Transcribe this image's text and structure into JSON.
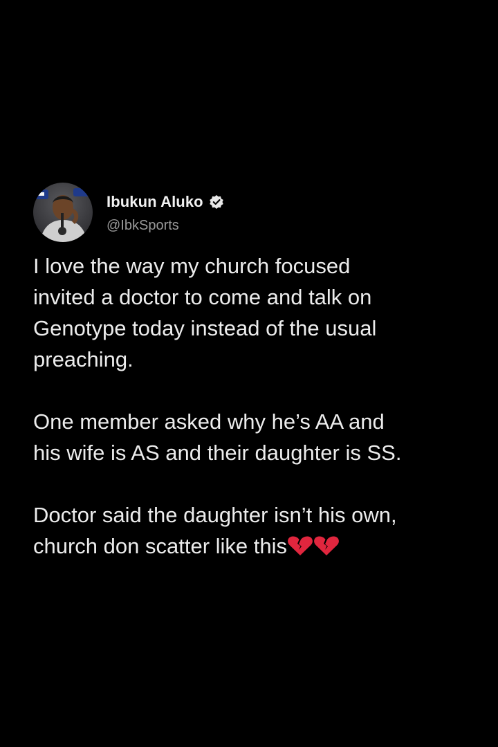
{
  "tweet": {
    "author": {
      "display_name": "Ibukun Aluko",
      "handle": "@IbkSports",
      "verified": true,
      "avatar_icon": "profile-photo"
    },
    "paragraphs": [
      [
        "I love the way my church focused",
        "invited a doctor to come and talk on",
        "Genotype today instead of the usual",
        "preaching."
      ],
      [
        "One member asked why he’s AA and",
        "his wife is AS and their daughter is SS."
      ],
      [
        "Doctor said the daughter isn’t his own,",
        "church don scatter like this"
      ]
    ],
    "trailing_emoji": "broken-heart-icon",
    "trailing_emoji_count": 2
  },
  "colors": {
    "background": "#000000",
    "text": "#ececec",
    "handle": "#9a9a9a",
    "heart": "#e0263e"
  }
}
